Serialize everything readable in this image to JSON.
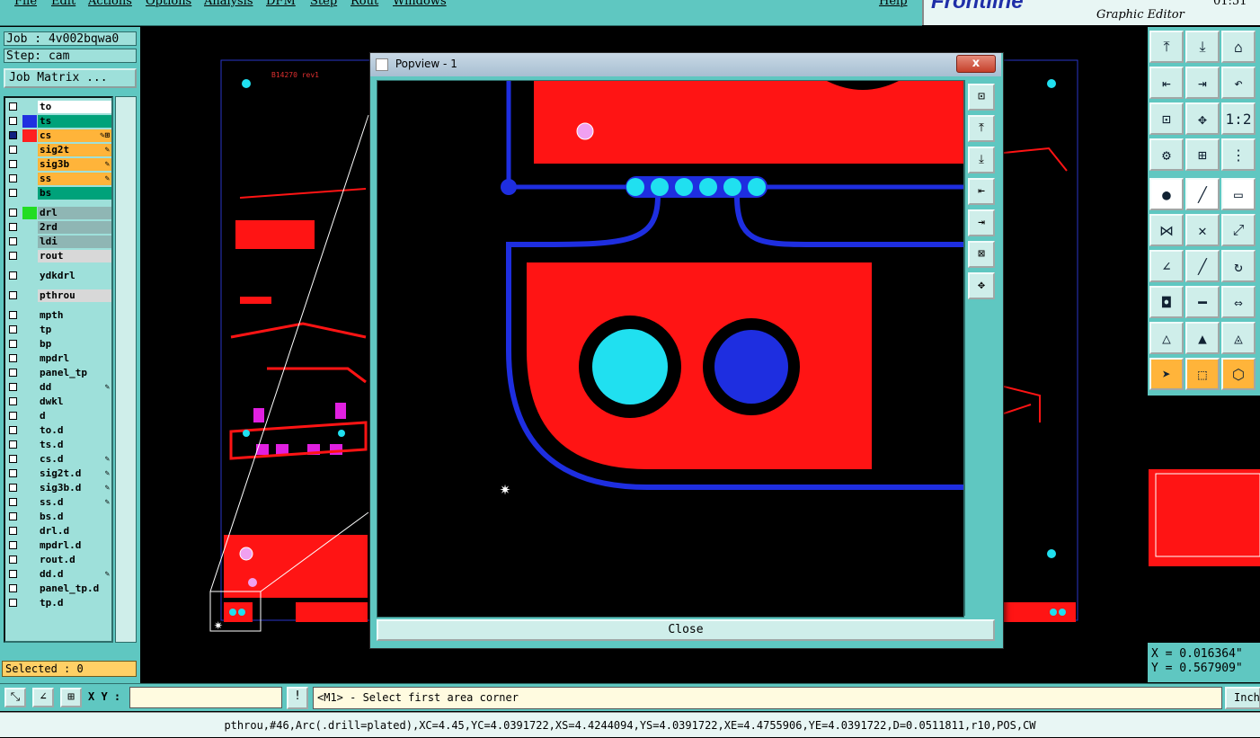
{
  "menu": [
    "File",
    "Edit",
    "Actions",
    "Options",
    "Analysis",
    "DFM",
    "Step",
    "Rout",
    "Windows"
  ],
  "help": "Help",
  "brand": {
    "logo": "Frontline",
    "subtitle": "Graphic Editor",
    "time": "01:51"
  },
  "job": {
    "job_label": "Job : 4v002bqwa0",
    "step_label": "Step: cam",
    "matrix_button": "Job Matrix ..."
  },
  "layers": [
    {
      "name": "to",
      "bg": "#ffffff",
      "swatch": ""
    },
    {
      "name": "ts",
      "bg": "#00a27a",
      "swatch": "#2030e0"
    },
    {
      "name": "cs",
      "bg": "#ffb43a",
      "swatch": "#ff2020",
      "flag": "✎⊞",
      "selected": true
    },
    {
      "name": "sig2t",
      "bg": "#ffb43a",
      "swatch": "",
      "flag": "✎"
    },
    {
      "name": "sig3b",
      "bg": "#ffb43a",
      "swatch": "",
      "flag": "✎"
    },
    {
      "name": "ss",
      "bg": "#ffb43a",
      "swatch": "",
      "flag": "✎"
    },
    {
      "name": "bs",
      "bg": "#00a27a",
      "swatch": ""
    },
    {
      "name": "drl",
      "bg": "#8fb6b4",
      "swatch": "#22dd22",
      "gap": true
    },
    {
      "name": "2rd",
      "bg": "#8fb6b4",
      "swatch": ""
    },
    {
      "name": "ldi",
      "bg": "#8fb6b4",
      "swatch": ""
    },
    {
      "name": "rout",
      "bg": "#d8d8d8",
      "swatch": ""
    },
    {
      "name": "ydkdrl",
      "bg": "#9ee0da",
      "swatch": "",
      "gap": true
    },
    {
      "name": "pthrou",
      "bg": "#d8d8d8",
      "swatch": "",
      "gap": true
    },
    {
      "name": "mpth",
      "bg": "#9ee0da",
      "swatch": "",
      "gap": true
    },
    {
      "name": "tp",
      "bg": "#9ee0da",
      "swatch": ""
    },
    {
      "name": "bp",
      "bg": "#9ee0da",
      "swatch": ""
    },
    {
      "name": "mpdrl",
      "bg": "#9ee0da",
      "swatch": ""
    },
    {
      "name": "panel_tp",
      "bg": "#9ee0da",
      "swatch": ""
    },
    {
      "name": "dd",
      "bg": "#9ee0da",
      "swatch": "",
      "flag": "✎"
    },
    {
      "name": "dwkl",
      "bg": "#9ee0da",
      "swatch": ""
    },
    {
      "name": "d",
      "bg": "#9ee0da",
      "swatch": ""
    },
    {
      "name": "to.d",
      "bg": "#9ee0da",
      "swatch": ""
    },
    {
      "name": "ts.d",
      "bg": "#9ee0da",
      "swatch": ""
    },
    {
      "name": "cs.d",
      "bg": "#9ee0da",
      "swatch": "",
      "flag": "✎"
    },
    {
      "name": "sig2t.d",
      "bg": "#9ee0da",
      "swatch": "",
      "flag": "✎"
    },
    {
      "name": "sig3b.d",
      "bg": "#9ee0da",
      "swatch": "",
      "flag": "✎"
    },
    {
      "name": "ss.d",
      "bg": "#9ee0da",
      "swatch": "",
      "flag": "✎"
    },
    {
      "name": "bs.d",
      "bg": "#9ee0da",
      "swatch": ""
    },
    {
      "name": "drl.d",
      "bg": "#9ee0da",
      "swatch": ""
    },
    {
      "name": "mpdrl.d",
      "bg": "#9ee0da",
      "swatch": ""
    },
    {
      "name": "rout.d",
      "bg": "#9ee0da",
      "swatch": ""
    },
    {
      "name": "dd.d",
      "bg": "#9ee0da",
      "swatch": "",
      "flag": "✎"
    },
    {
      "name": "panel_tp.d",
      "bg": "#9ee0da",
      "swatch": ""
    },
    {
      "name": "tp.d",
      "bg": "#9ee0da",
      "swatch": ""
    }
  ],
  "selected_label": "Selected : 0",
  "board_label": "B14270 rev1",
  "popview": {
    "title": "Popview - 1",
    "close_x": "x",
    "close_button": "Close"
  },
  "command": {
    "xy_label": "X Y :",
    "xy_value": "",
    "prompt": "<M1> - Select first area corner",
    "unit_button": "Inch"
  },
  "coords": {
    "x": "X = 0.016364\"",
    "y": "Y = 0.567909\""
  },
  "status": "pthrou,#46,Arc(.drill=plated),XC=4.45,YC=4.0391722,XS=4.4244094,YS=4.0391722,XE=4.4755906,YE=4.0391722,D=0.0511811,r10,POS,CW",
  "colors": {
    "panel": "#5fc7c1",
    "copper": "#ff1414",
    "trace": "#1e2ee0",
    "pad": "#20e0f0",
    "hole": "#f0a0f0"
  }
}
